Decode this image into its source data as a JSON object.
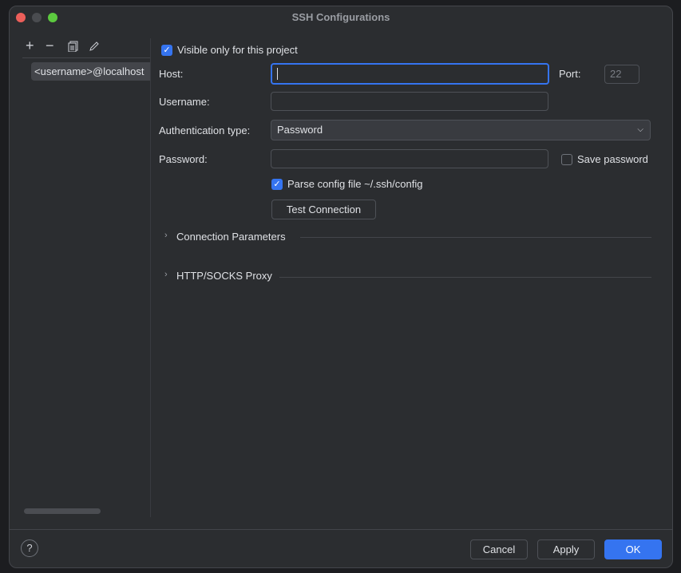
{
  "window": {
    "title": "SSH Configurations"
  },
  "toolbar": {
    "add": "+",
    "remove": "−",
    "copy": "copy-icon",
    "edit": "pencil-icon"
  },
  "list": {
    "items": [
      "<username>@localhost"
    ]
  },
  "form": {
    "visible_only": {
      "label": "Visible only for this project",
      "checked": true
    },
    "host": {
      "label": "Host:",
      "value": ""
    },
    "port": {
      "label": "Port:",
      "placeholder": "22"
    },
    "username": {
      "label": "Username:",
      "value": ""
    },
    "auth": {
      "label": "Authentication type:",
      "value": "Password"
    },
    "password": {
      "label": "Password:",
      "value": ""
    },
    "save_password": {
      "label": "Save password",
      "checked": false
    },
    "parse_config": {
      "label": "Parse config file ~/.ssh/config",
      "checked": true
    },
    "test_connection": "Test Connection",
    "sections": [
      "Connection Parameters",
      "HTTP/SOCKS Proxy"
    ]
  },
  "footer": {
    "help": "?",
    "cancel": "Cancel",
    "apply": "Apply",
    "ok": "OK"
  },
  "colors": {
    "accent": "#3574f0",
    "background": "#2b2d30"
  }
}
